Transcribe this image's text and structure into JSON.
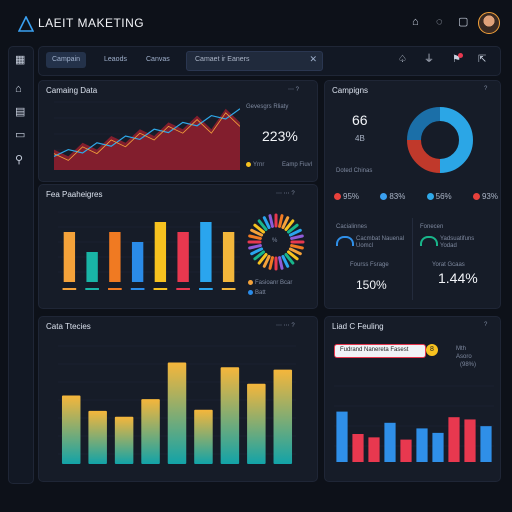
{
  "app": {
    "title": "LAEIT MAKETING"
  },
  "header": {
    "icons": [
      "home-icon",
      "chat-icon",
      "bag-icon"
    ]
  },
  "toolbar": {
    "tabs": [
      "Campain",
      "Leaods",
      "Canvas"
    ],
    "search_text": "Camaet ir Eaners",
    "icons": [
      "bell-icon",
      "filter-icon",
      "flag-icon",
      "share-icon"
    ]
  },
  "sidebar": {
    "items": [
      "grid-icon",
      "home-icon",
      "building-icon",
      "inbox-icon",
      "user-search-icon"
    ]
  },
  "campaign_data": {
    "title": "Camaing Data",
    "subtitle": "Gevesgrs Rliaty",
    "value": "223%",
    "note": "Yrnr",
    "sub_note": "Eamp Fiuvl"
  },
  "campaigns": {
    "title": "Campigns",
    "value1": "66",
    "value2": "4B",
    "chart_label": "Doted Chinas",
    "legend": [
      {
        "color": "#e8413c",
        "label": "95%"
      },
      {
        "color": "#3aa0f0",
        "label": "83%"
      },
      {
        "color": "#2fa8e8",
        "label": "56%"
      },
      {
        "color": "#e8413c",
        "label": "93%"
      }
    ],
    "left_title": "Cacialinnes",
    "left_sub": "Cacmbat Nauenal",
    "left_sub2": "Uomcl",
    "left_label": "Fourss Fsrage",
    "left_value": "150%",
    "right_title": "Fonecen",
    "right_sub": "Yadsuatifuns",
    "right_sub2": "Yodad",
    "right_label": "Yorat Gcaas",
    "right_value": "1.44%"
  },
  "performance": {
    "title": "Fea Paaheigres",
    "gauge_label": "%",
    "legend_items": [
      "Fasioanr Bcar",
      "Batt"
    ]
  },
  "data_trends": {
    "title": "Cata Ttecies"
  },
  "lead_funnel": {
    "title": "Liad C Feuling",
    "bar_text": "Fudrand Nanereta Fasest",
    "badge": "8",
    "side_values": [
      "Mth",
      "Asoro"
    ],
    "percent": "(98%)"
  },
  "chart_data": [
    {
      "type": "area",
      "title": "Camaing Data",
      "series": [
        {
          "values": [
            3,
            2,
            4,
            3,
            5,
            4,
            6,
            5,
            7,
            6,
            8,
            6,
            9,
            7
          ]
        },
        {
          "values": [
            2,
            3,
            2.5,
            4,
            3.5,
            5,
            4.5,
            6,
            5.5,
            7,
            6.5,
            8,
            7.5,
            9
          ]
        }
      ],
      "ylim": [
        0,
        10
      ]
    },
    {
      "type": "donut",
      "values": [
        50,
        25,
        25
      ],
      "colors": [
        "#2ba6e6",
        "#c0392b",
        "#1b6fa8"
      ]
    },
    {
      "type": "bar",
      "title": "Fea Paaheigres",
      "values": [
        5,
        3,
        5,
        4,
        6,
        5,
        6,
        5
      ],
      "colors": [
        "#f4a23a",
        "#19b5a6",
        "#f07a22",
        "#2a8be8",
        "#f7c21f",
        "#e8384f",
        "#2aa5ee",
        "#f2b63b"
      ],
      "ylim": [
        0,
        7
      ]
    },
    {
      "type": "bar",
      "title": "Cata Ttecies",
      "values": [
        5.8,
        4.5,
        4.0,
        5.5,
        8.6,
        4.6,
        8.2,
        6.8,
        8.0
      ],
      "ylim": [
        0,
        10
      ]
    },
    {
      "type": "bar",
      "title": "Liad C Feuling",
      "values": [
        4.5,
        2.5,
        2.2,
        3.5,
        2.0,
        3.0,
        2.6,
        4.0,
        3.8,
        3.2
      ],
      "colors": [
        "#2f8fe8",
        "#e8384f",
        "#e8384f",
        "#2f8fe8",
        "#e8384f",
        "#2f8fe8",
        "#2f8fe8",
        "#e8384f",
        "#e8384f",
        "#2f8fe8"
      ],
      "ylim": [
        0,
        10
      ]
    }
  ]
}
